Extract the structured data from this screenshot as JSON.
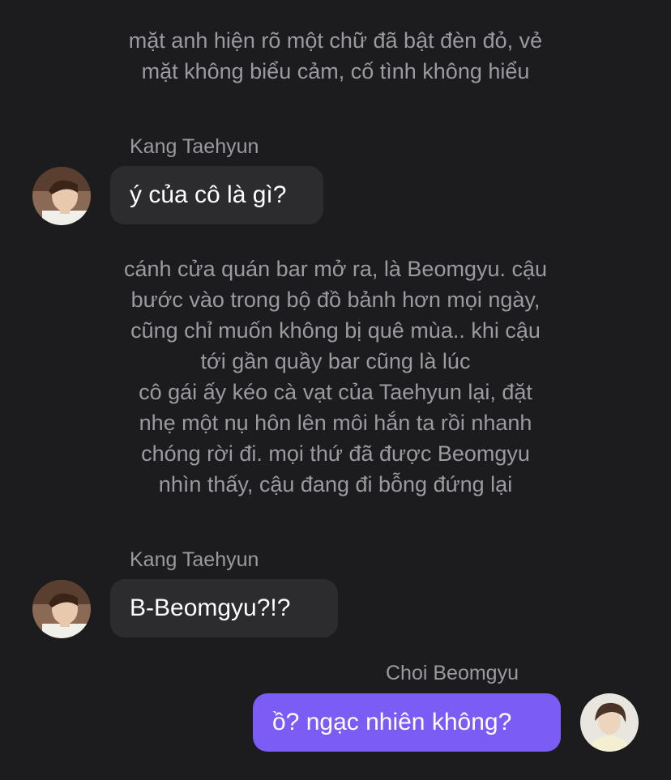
{
  "colors": {
    "background": "#1c1c1e",
    "narration_text": "#9a9aa0",
    "incoming_bubble": "#2c2c2e",
    "outgoing_bubble": "#7b5cf5",
    "bubble_text": "#ffffff"
  },
  "chat": {
    "narration_1": "mặt anh hiện rõ một chữ đã bật đèn đỏ, vẻ\nmặt không biểu cảm, cố tình không hiểu",
    "message_1": {
      "sender": "Kang Taehyun",
      "text": "ý của cô là gì?",
      "avatar": "avatar-kang-taehyun"
    },
    "narration_2": "cánh cửa quán bar mở ra, là Beomgyu. cậu\nbước vào trong bộ đồ bảnh hơn mọi ngày,\ncũng chỉ muốn không bị quê mùa.. khi cậu\ntới gần quầy bar cũng là lúc\ncô gái ấy kéo cà vạt của Taehyun lại, đặt\nnhẹ một nụ hôn lên môi hắn ta rồi nhanh\nchóng rời đi. mọi thứ đã được Beomgyu\nnhìn thấy, cậu đang đi bỗng đứng lại",
    "message_2": {
      "sender": "Kang Taehyun",
      "text": "B-Beomgyu?!?",
      "avatar": "avatar-kang-taehyun"
    },
    "message_3": {
      "sender": "Choi Beomgyu",
      "text": "ồ? ngạc nhiên không?",
      "avatar": "avatar-choi-beomgyu"
    }
  }
}
